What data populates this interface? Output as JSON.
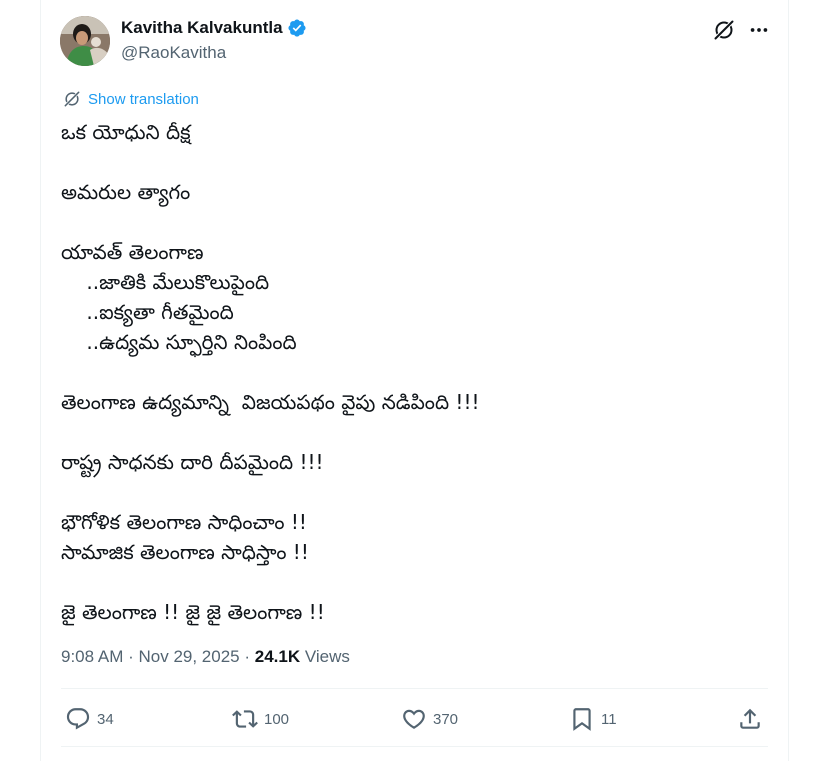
{
  "author": {
    "display_name": "Kavitha Kalvakuntla",
    "handle": "@RaoKavitha",
    "verified": true
  },
  "header_icons": [
    "grok-icon",
    "more-icon"
  ],
  "translation": {
    "label": "Show translation"
  },
  "tweet": {
    "lines": [
      "ఒక యోధుని దీక్ష",
      "",
      "అమరుల త్యాగం",
      "",
      "యావత్ తెలంగాణ",
      "    ..జాతికి మేలుకొలుపైంది",
      "    ..ఐక్యతా గీతమైంది",
      "    ..ఉద్యమ స్ఫూర్తిని నింపింది",
      "",
      "తెలంగాణ ఉద్యమాన్ని  విజయపథం వైపు నడిపింది !!!",
      "",
      "రాష్ట్ర సాధనకు దారి దీపమైంది !!!",
      "",
      "భౌగోళిక తెలంగాణ సాధించాం !!",
      "సామాజిక తెలంగాణ సాధిస్తాం !!",
      "",
      "జై తెలంగాణ !! జై జై తెలంగాణ !!"
    ]
  },
  "meta": {
    "time": "9:08 AM",
    "separator": " · ",
    "date": "Nov 29, 2025",
    "views_count": "24.1K",
    "views_label": " Views"
  },
  "actions": {
    "replies": "34",
    "reposts": "100",
    "likes": "370",
    "bookmarks": "11"
  },
  "colors": {
    "accent": "#1d9bf0",
    "secondary_text": "#536471",
    "primary_text": "#0f1419",
    "border": "#eff3f4"
  }
}
